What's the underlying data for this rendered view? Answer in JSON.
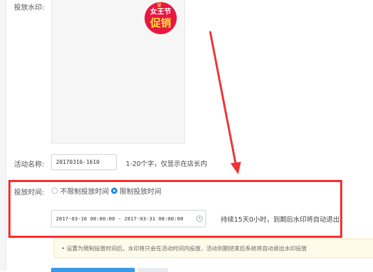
{
  "labels": {
    "watermark": "投放水印:",
    "activity_name": "活动名称:",
    "delivery_time": "投放时间:"
  },
  "watermark_badge": {
    "line1": "女王节",
    "line2": "促销",
    "crown": "♛"
  },
  "activity_name": {
    "value": "20170316-1610",
    "hint": "1-20个字，仅显示在店长内"
  },
  "delivery_time": {
    "options": [
      "不限制投放时间",
      "限制投放时间"
    ],
    "selected": "限制投放时间",
    "range_value": "2017-03-16 00:00:00 - 2017-03-31 00:00:00",
    "duration_hint": "持续15天0小时，到期后水印将自动退出"
  },
  "notice": "• 设置为限制投放时间后，水印将只会在活动时间内投放，活动到期结束后系统将自动退出水印投放",
  "colors": {
    "annotation_red": "#ff2a2a",
    "radio_blue": "#1e88e5",
    "badge_red": "#e8173f"
  },
  "icons": {
    "date_picker": "clock-icon"
  }
}
